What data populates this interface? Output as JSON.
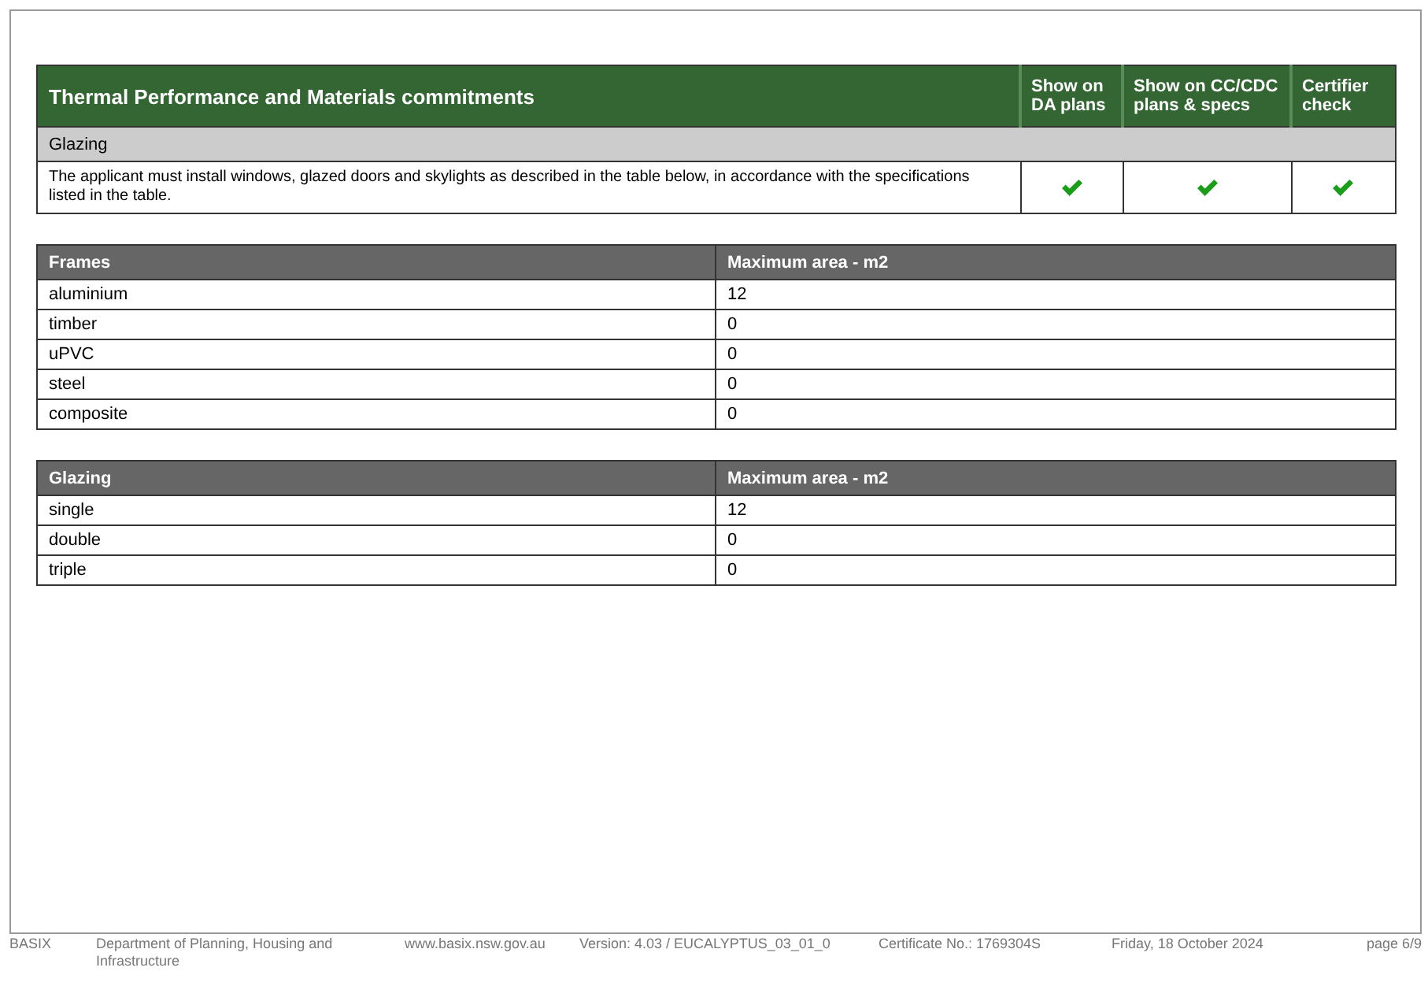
{
  "commitments": {
    "title": "Thermal Performance and Materials commitments",
    "columns": [
      "Show on DA plans",
      "Show on CC/CDC plans & specs",
      "Certifier check"
    ],
    "section": "Glazing",
    "rows": [
      {
        "text": "The applicant must install windows, glazed doors and skylights as described in the table below, in accordance with the specifications listed in the table.",
        "checks": [
          {
            "checked": true
          },
          {
            "checked": true
          },
          {
            "checked": true
          }
        ]
      }
    ]
  },
  "tables": [
    {
      "columns": [
        "Frames",
        "Maximum area - m2"
      ],
      "rows": [
        [
          "aluminium",
          "12"
        ],
        [
          "timber",
          "0"
        ],
        [
          "uPVC",
          "0"
        ],
        [
          "steel",
          "0"
        ],
        [
          "composite",
          "0"
        ]
      ]
    },
    {
      "columns": [
        "Glazing",
        "Maximum area - m2"
      ],
      "rows": [
        [
          "single",
          "12"
        ],
        [
          "double",
          "0"
        ],
        [
          "triple",
          "0"
        ]
      ]
    }
  ],
  "footer": [
    "BASIX",
    "Department of Planning, Housing and Infrastructure",
    "www.basix.nsw.gov.au",
    "Version: 4.03 / EUCALYPTUS_03_01_0",
    "Certificate No.: 1769304S",
    "Friday, 18 October 2024",
    "page 6/9"
  ]
}
